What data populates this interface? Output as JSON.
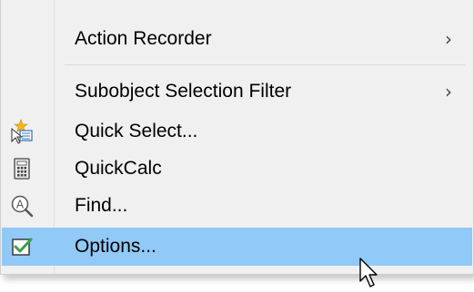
{
  "menu": {
    "items": [
      {
        "label": "Action Recorder",
        "submenu_arrow": "›",
        "icon": ""
      },
      {
        "label": "Subobject Selection Filter",
        "submenu_arrow": "›",
        "icon": ""
      },
      {
        "label": "Quick Select...",
        "icon": "quick-select-icon"
      },
      {
        "label": "QuickCalc",
        "icon": "calculator-icon"
      },
      {
        "label": "Find...",
        "icon": "find-icon"
      },
      {
        "label": "Options...",
        "icon": "options-checkbox-icon",
        "highlighted": true
      }
    ]
  },
  "colors": {
    "menu_background": "#f0f0f0",
    "highlight": "#91c9f7",
    "checkmark": "#3aa14a",
    "separator": "#d8d8d8"
  }
}
